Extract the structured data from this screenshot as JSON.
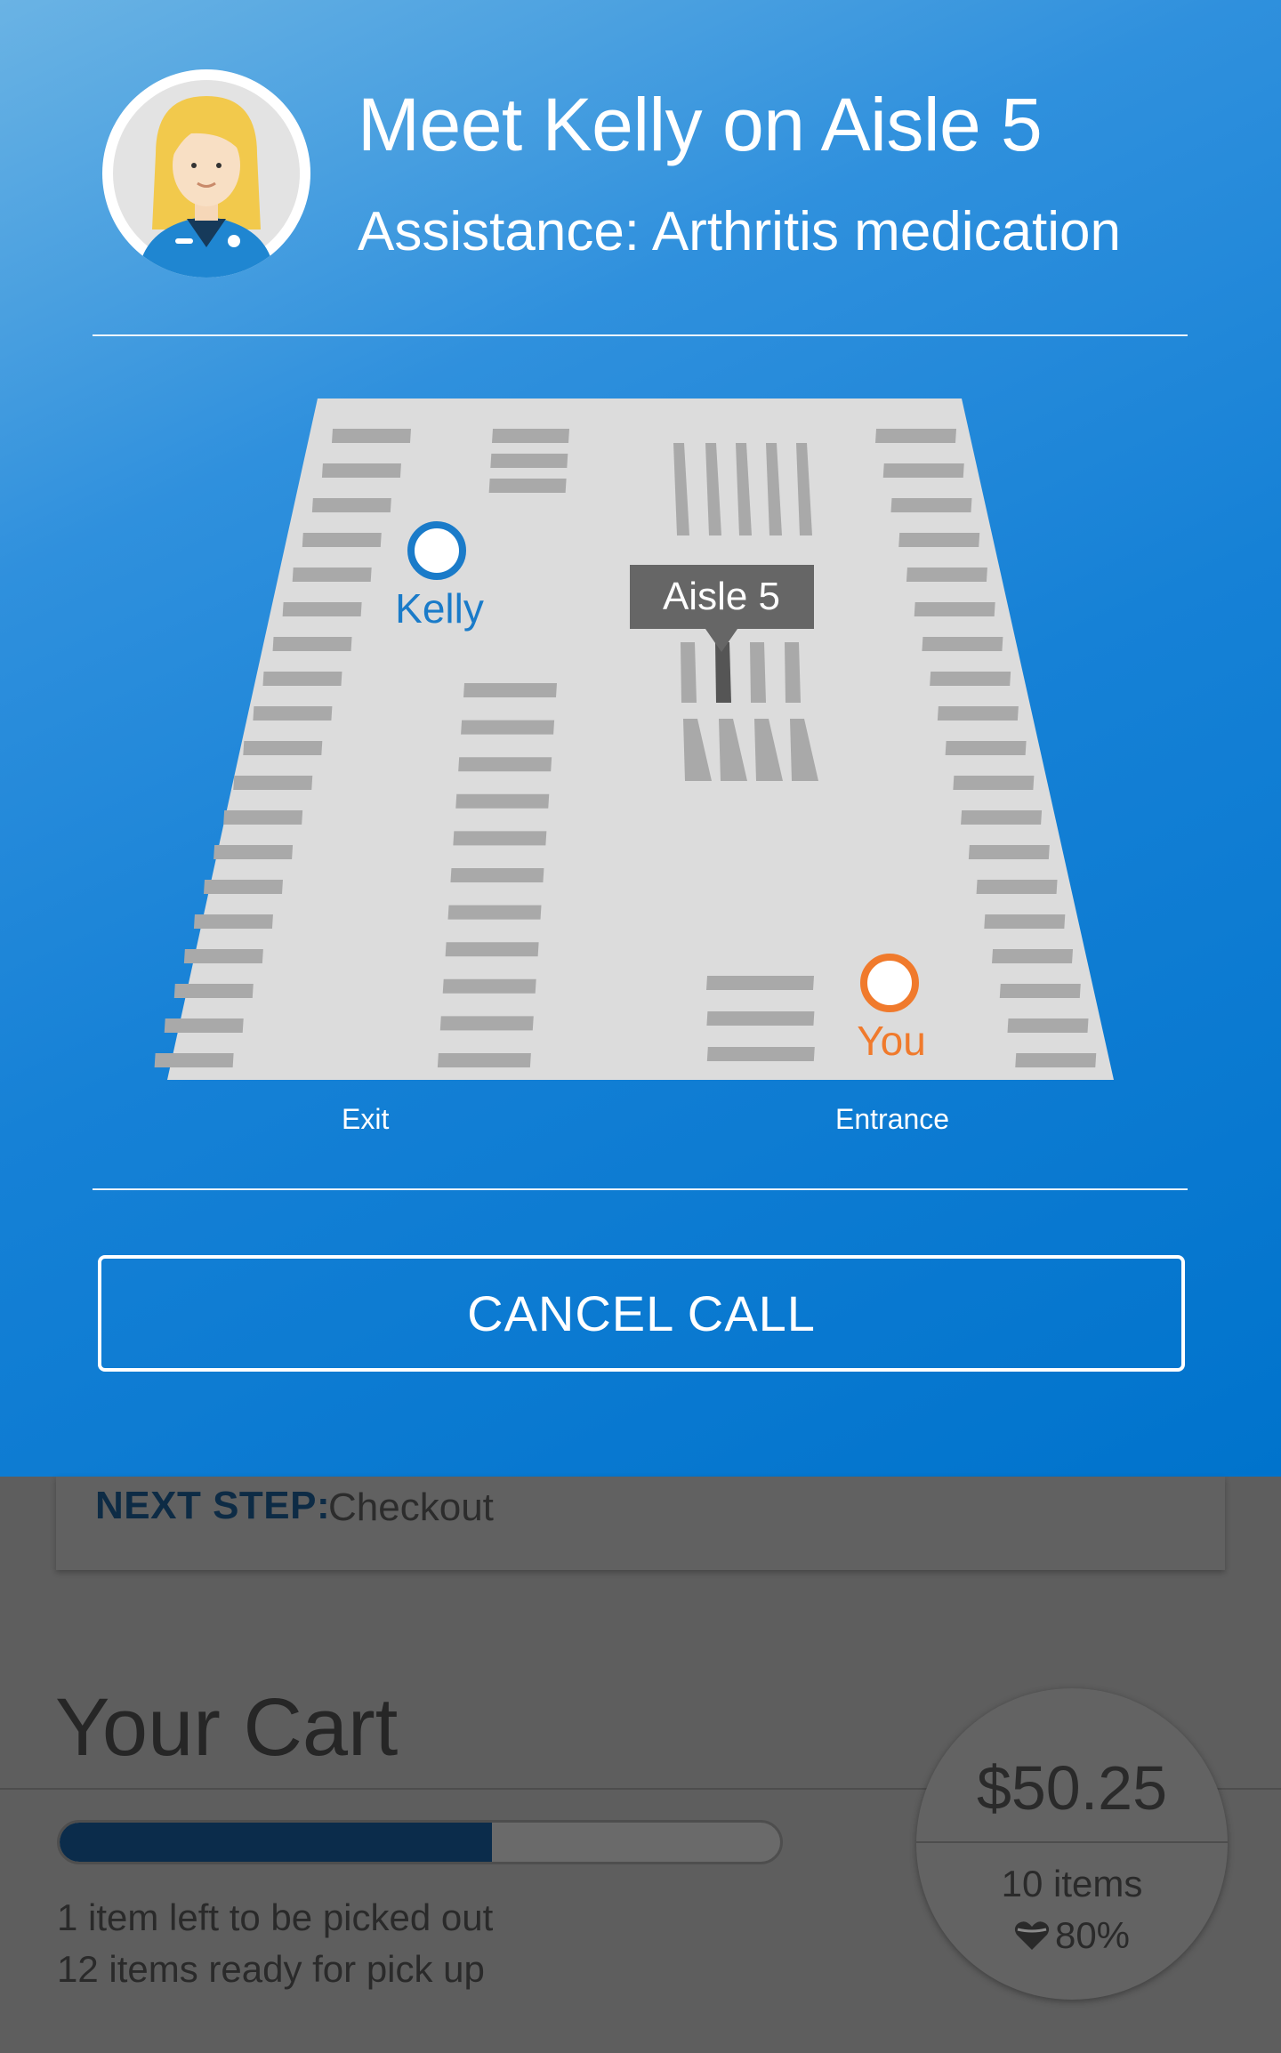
{
  "modal": {
    "title": "Meet Kelly on Aisle 5",
    "subtitle": "Assistance: Arthritis medication",
    "cancel_label": "CANCEL CALL",
    "accent_color": "#0073cc"
  },
  "map": {
    "kelly_label": "Kelly",
    "you_label": "You",
    "aisle_callout": "Aisle 5",
    "exit_label": "Exit",
    "entrance_label": "Entrance",
    "kelly_color": "#1a7bc9",
    "you_color": "#f07a2c"
  },
  "next_step": {
    "label": "NEXT STEP:",
    "value": "Checkout"
  },
  "cart": {
    "title": "Your Cart",
    "progress_fraction": 0.6,
    "left_text": "1 item left to be picked out",
    "ready_text": "12 items ready for pick up",
    "total": "$50.25",
    "item_count": "10 items",
    "health_score": "80%",
    "health_icon": "heart-icon"
  }
}
